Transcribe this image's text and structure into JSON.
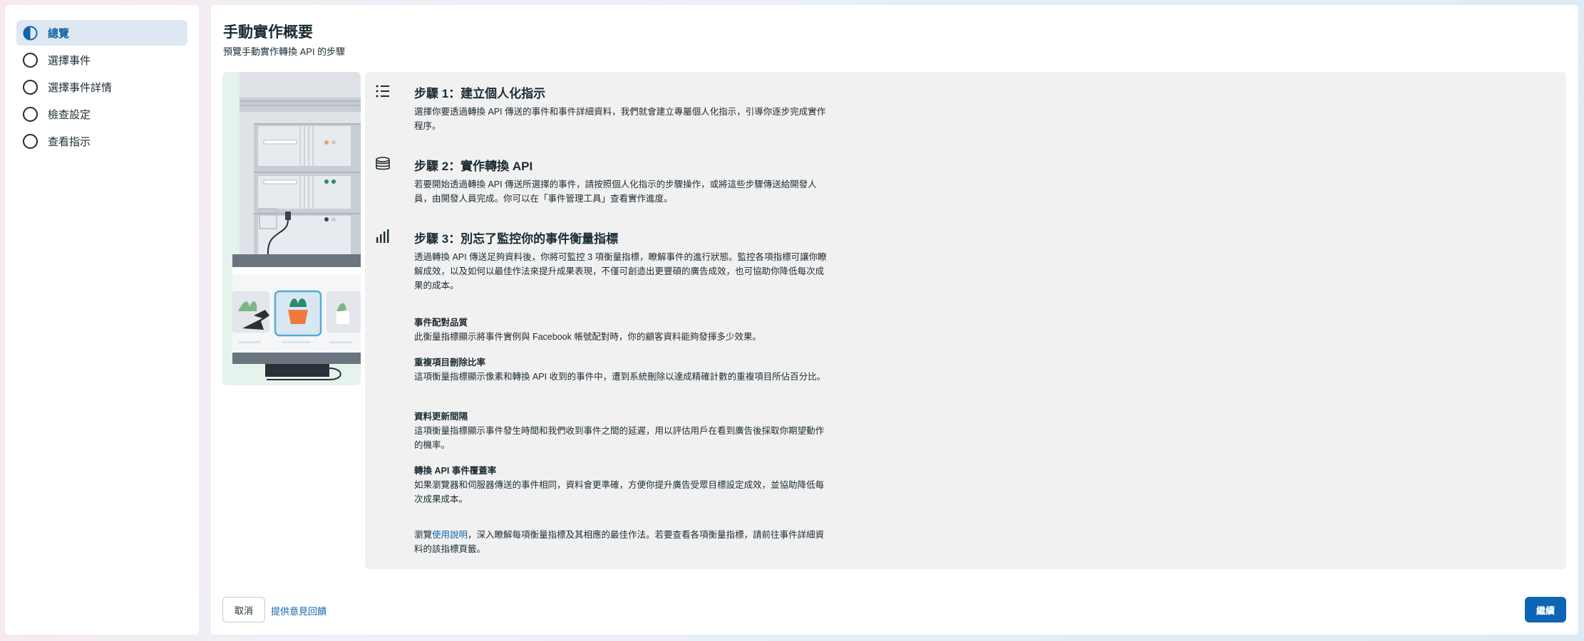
{
  "sidebar": {
    "items": [
      {
        "label": "總覽",
        "active": true,
        "icon": "half-circle-icon"
      },
      {
        "label": "選擇事件",
        "active": false,
        "icon": "circle-icon"
      },
      {
        "label": "選擇事件詳情",
        "active": false,
        "icon": "circle-icon"
      },
      {
        "label": "檢查設定",
        "active": false,
        "icon": "circle-icon"
      },
      {
        "label": "查看指示",
        "active": false,
        "icon": "circle-icon"
      }
    ]
  },
  "header": {
    "title": "手動實作概要",
    "subtitle": "預覽手動實作轉換 API 的步驟"
  },
  "steps": [
    {
      "icon": "list-icon",
      "title": "步驟 1：建立個人化指示",
      "body": "選擇你要透過轉換 API 傳送的事件和事件詳細資料，我們就會建立專屬個人化指示，引導你逐步完成實作程序。"
    },
    {
      "icon": "database-icon",
      "title": "步驟 2：實作轉換 API",
      "body": "若要開始透過轉換 API 傳送所選擇的事件，請按照個人化指示的步驟操作，或將這些步驟傳送給開發人員，由開發人員完成。你可以在「事件管理工具」查看實作進度。"
    },
    {
      "icon": "bar-chart-icon",
      "title": "步驟 3：別忘了監控你的事件衡量指標",
      "body": "透過轉換 API 傳送足夠資料後，你將可監控 3 項衡量指標，瞭解事件的進行狀態。監控各項指標可讓你瞭解成效，以及如何以最佳作法來提升成果表現，不僅可創造出更豐碩的廣告成效，也可協助你降低每次成果的成本。"
    }
  ],
  "metrics": [
    {
      "title": "事件配對品質",
      "body": "此衡量指標顯示將事件實例與 Facebook 帳號配對時，你的顧客資料能夠發揮多少效果。"
    },
    {
      "title": "重複項目刪除比率",
      "body": "這項衡量指標顯示像素和轉換 API 收到的事件中，遭到系統刪除以達成精確計數的重複項目所佔百分比。"
    },
    {
      "title": "資料更新間隔",
      "body": "這項衡量指標顯示事件發生時間和我們收到事件之間的延遲，用以評估用戶在看到廣告後採取你期望動作的機率。"
    },
    {
      "title": "轉換 API 事件覆蓋率",
      "body": "如果瀏覽器和伺服器傳送的事件相同，資料會更準確，方便你提升廣告受眾目標設定成效，並協助降低每次成果成本。"
    }
  ],
  "footer_note": {
    "prefix": "瀏覽",
    "link": "使用說明",
    "suffix": "，深入瞭解每項衡量指標及其相應的最佳作法。若要查看各項衡量指標，請前往事件詳細資料的該指標頁籤。"
  },
  "actions": {
    "cancel_label": "取消",
    "feedback_label": "提供意見回饋",
    "continue_label": "繼續"
  },
  "colors": {
    "accent": "#1463a8",
    "primary_button": "#0f65b5",
    "panel_bg": "#f1f1f1",
    "active_nav_bg": "#dde8f3"
  }
}
